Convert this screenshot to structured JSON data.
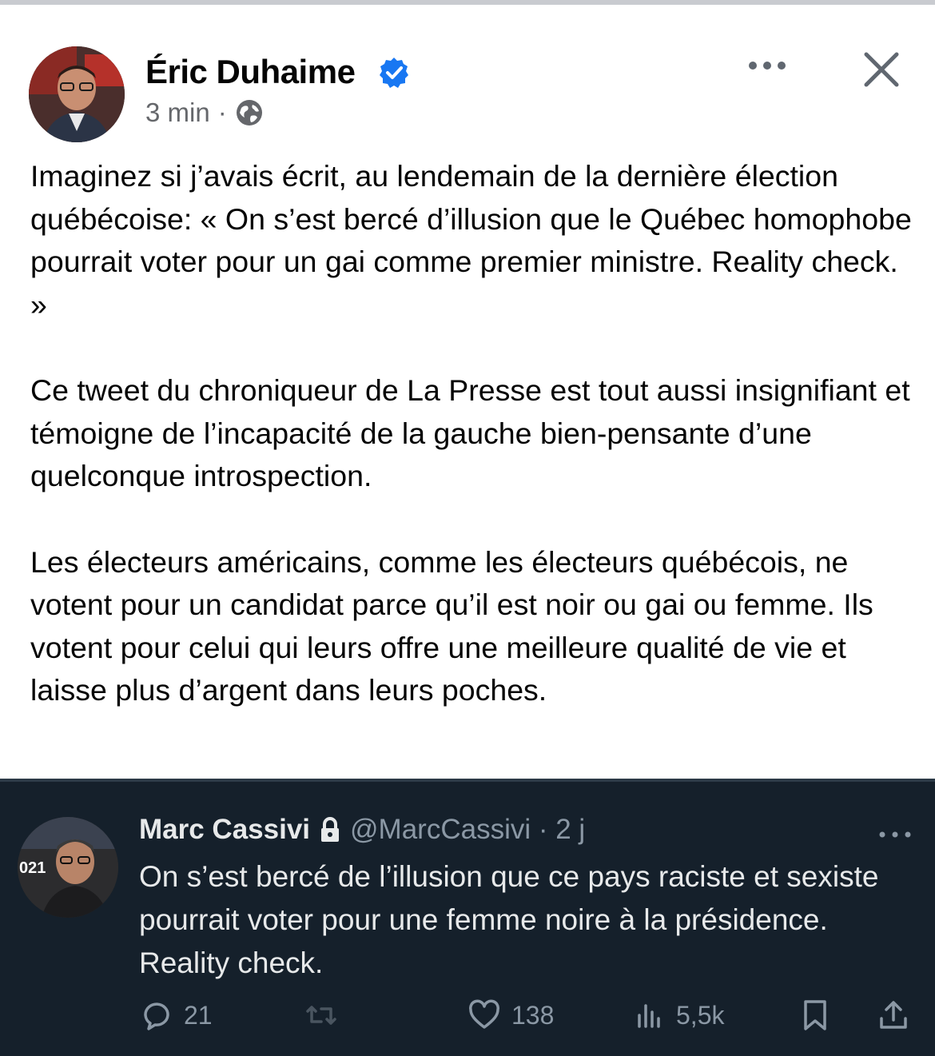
{
  "post": {
    "author": "Éric Duhaime",
    "time": "3 min",
    "separator": "·",
    "paragraphs": [
      "Imaginez si j’avais écrit, au lendemain de la dernière élection québécoise: « On s’est bercé d’illusion que le Québec homophobe pourrait voter pour un gai comme premier ministre. Reality check. »",
      "Ce tweet du chroniqueur de La Presse est tout aussi insignifiant et témoigne de l’incapacité de la gauche bien-pensante d’une quelconque introspection.",
      "Les électeurs américains, comme les électeurs québécois, ne votent pour un candidat parce qu’il est noir ou gai ou femme. Ils votent pour celui qui leurs offre une meilleure qualité de vie et laisse plus d’argent dans leurs poches."
    ]
  },
  "tweet": {
    "name": "Marc Cassivi",
    "handle": "@MarcCassivi · 2 j",
    "avatar_text": "021",
    "text": "On s’est bercé de l’illusion que ce pays raciste et sexiste pourrait voter pour une femme noire à la présidence. Reality check.",
    "replies": "21",
    "likes": "138",
    "views": "5,5k"
  },
  "icons": {
    "verified": "verified-badge-icon",
    "globe": "globe-icon",
    "more": "more-horizontal-icon",
    "close": "close-icon",
    "lock": "lock-icon",
    "reply": "reply-icon",
    "retweet": "retweet-icon",
    "like": "heart-icon",
    "views": "views-icon",
    "bookmark": "bookmark-icon",
    "share": "share-icon"
  },
  "colors": {
    "verified": "#1877f2",
    "tweet_bg": "#15202b",
    "tweet_text": "#e7e9ea",
    "muted": "#8b98a5"
  }
}
